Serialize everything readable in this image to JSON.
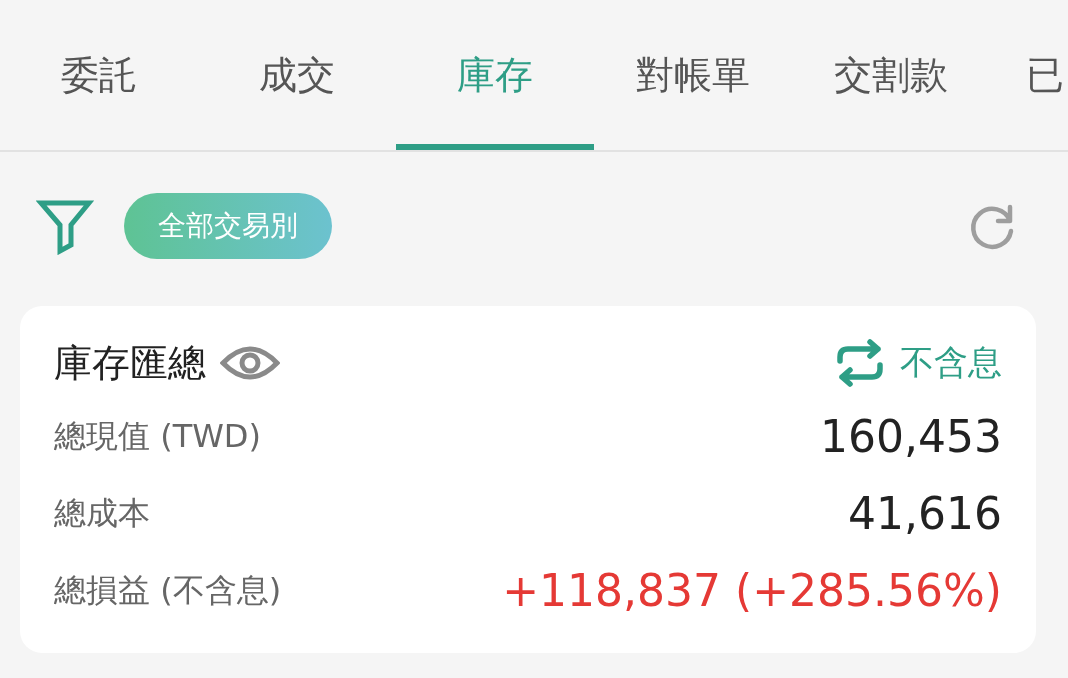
{
  "tabs": [
    {
      "label": "委託",
      "selected": false
    },
    {
      "label": "成交",
      "selected": false
    },
    {
      "label": "庫存",
      "selected": true
    },
    {
      "label": "對帳單",
      "selected": false
    },
    {
      "label": "交割款",
      "selected": false
    },
    {
      "label": "已",
      "selected": false
    }
  ],
  "filter": {
    "chip": "全部交易別"
  },
  "summary": {
    "title": "庫存匯總",
    "toggle": "不含息",
    "rows": [
      {
        "label": "總現值 (TWD)",
        "value": "160,453",
        "kind": "plain"
      },
      {
        "label": "總成本",
        "value": "41,616",
        "kind": "plain"
      },
      {
        "label": "總損益 (不含息)",
        "value": "+118,837 (+285.56%)",
        "kind": "gain"
      }
    ]
  }
}
